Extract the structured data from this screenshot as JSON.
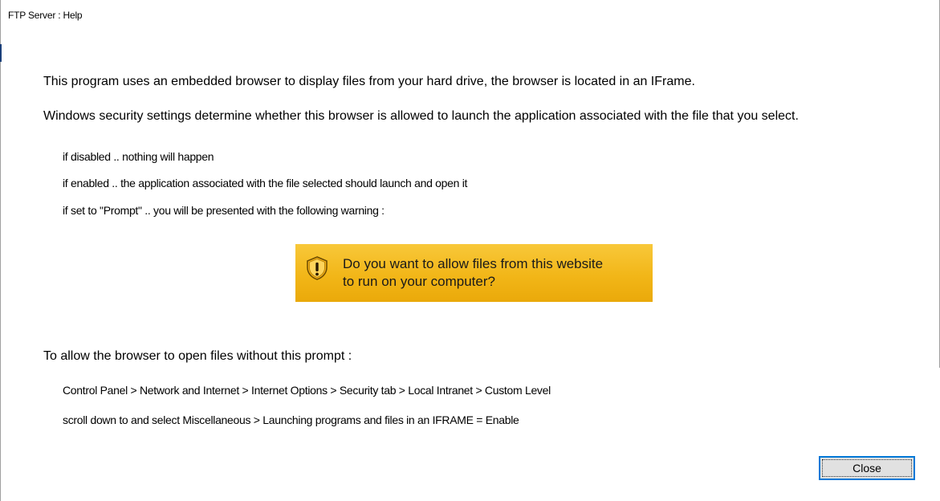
{
  "window": {
    "title": "FTP Server : Help"
  },
  "content": {
    "intro": "This program uses an embedded browser to display files from your hard drive, the browser is located in an IFrame.",
    "security_note": "Windows security settings determine whether this browser is allowed to launch the application associated with the file that you select.",
    "options": [
      "if disabled .. nothing will happen",
      "if enabled .. the application associated with the file selected should launch and open it",
      "if set to \"Prompt\" .. you will be presented with the following warning :"
    ],
    "warning_banner": {
      "line1": "Do you want to allow files from this website",
      "line2": "to run on your computer?",
      "icon": "shield-warning-icon",
      "color": "#f2b618"
    },
    "allow_heading": "To allow the browser to open files without this prompt :",
    "steps": [
      "Control Panel > Network and Internet > Internet Options > Security tab > Local Intranet > Custom Level",
      "scroll down to and select Miscellaneous > Launching programs and files in an IFRAME = Enable"
    ]
  },
  "buttons": {
    "close_label": "Close",
    "focus_color": "#0078d7"
  }
}
